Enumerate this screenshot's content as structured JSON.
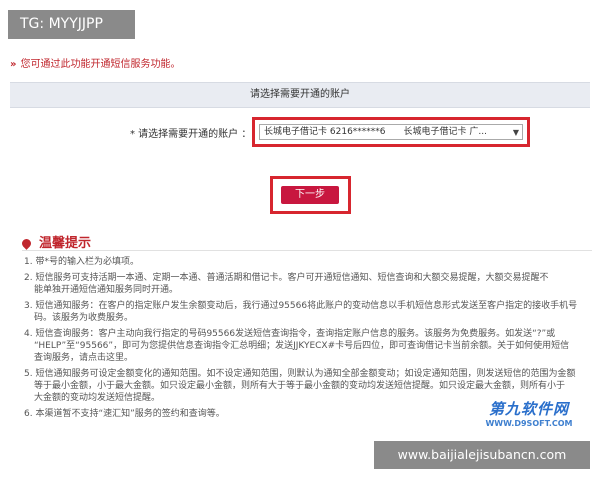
{
  "overlay_tag": "TG: MYYJJPP",
  "notice": {
    "arrows": "»",
    "text": "您可通过此功能开通短信服务功能。"
  },
  "panel_title": "请选择需要开通的账户",
  "account_field": {
    "label": "* 请选择需要开通的账户 ：",
    "selected_type": "长城电子借记卡",
    "selected_number": "6216******6",
    "selected_type_repeat": "长城电子借记卡 广...",
    "arrow": "▼"
  },
  "next_button": "下一步",
  "tips_title": "温馨提示",
  "tips": [
    {
      "line1": "1. 带*号的输入栏为必填项。",
      "line2": ""
    },
    {
      "line1": "2. 短信服务可支持活期一本通、定期一本通、普通活期和借记卡。客户可开通短信通知、短信查询和大额交易提醒，大额交易提醒不",
      "line2": "能单独开通短信通知服务同时开通。"
    },
    {
      "line1": "3. 短信通知服务：在客户的指定账户发生余额变动后，我行通过95566将此账户的变动信息以手机短信息形式发送至客户指定的接收手机号",
      "line2": "码。该服务为收费服务。"
    },
    {
      "line1": "4. 短信查询服务：客户主动向我行指定的号码95566发送短信查询指令，查询指定账户信息的服务。该服务为免费服务。如发送“?”或",
      "line2": "“HELP”至“95566”，即可为您提供信息查询指令汇总明细；发送JJKYECX#卡号后四位，即可查询借记卡当前余额。关于如何使用短信",
      "line3": "查询服务，请点击这里。"
    },
    {
      "line1": "5. 短信通知服务可设定金额变化的通知范围。如不设定通知范围，则默认为通知全部金额变动；如设定通知范围，则发送短信的范围为金额",
      "line2": "等于最小金额，小于最大金额。如只设定最小金额，则所有大于等于最小金额的变动均发送短信提醒。如只设定最大金额，则所有小于",
      "line3": "大金额的变动均发送短信提醒。"
    },
    {
      "line1": "6. 本渠道暂不支持“速汇知”服务的签约和查询等。",
      "line2": ""
    }
  ],
  "watermark": {
    "logo": "第九软件网",
    "url": "WWW.D9SOFT.COM"
  },
  "caption": "www.baijialejisubancn.com"
}
